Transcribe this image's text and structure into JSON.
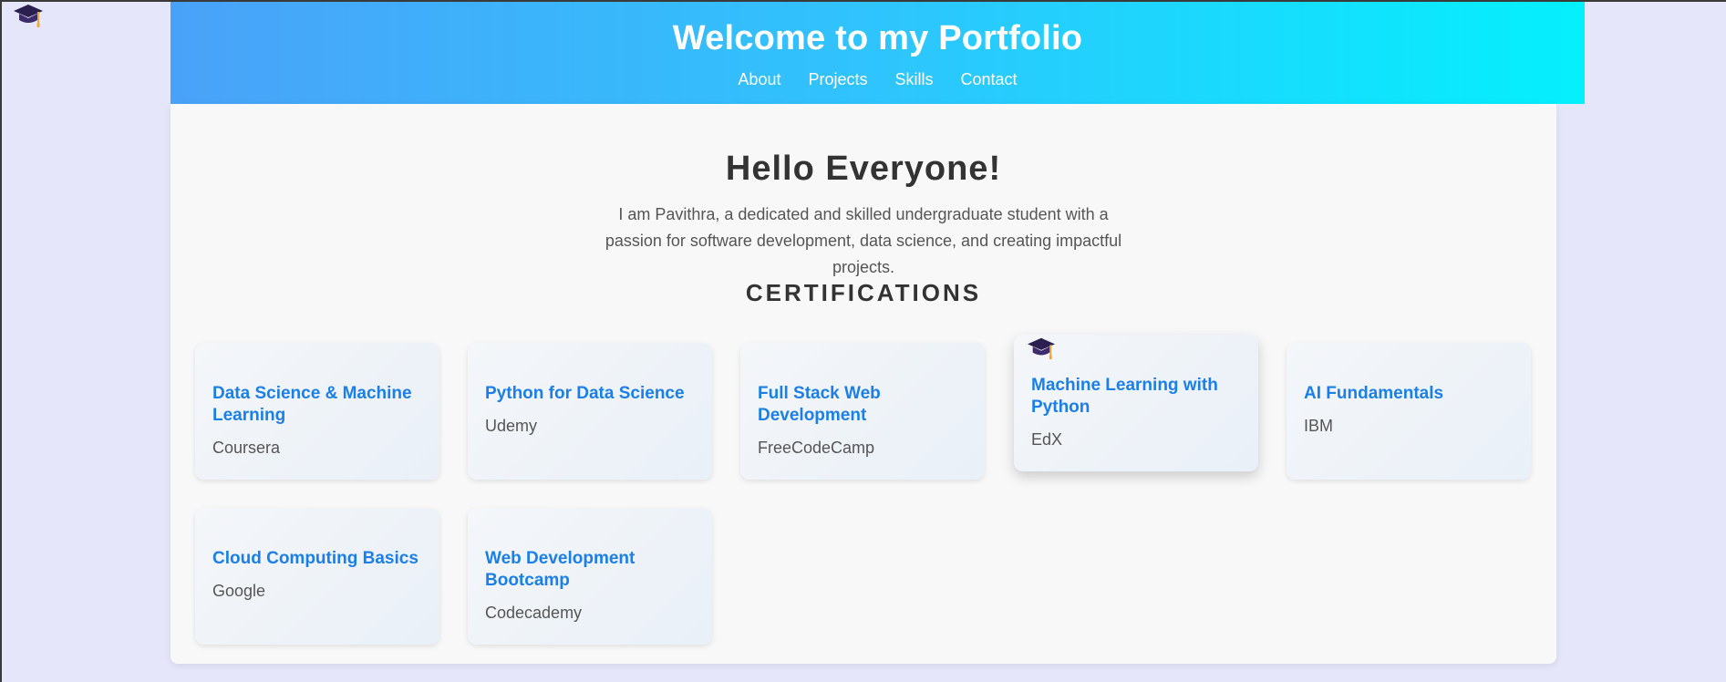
{
  "header": {
    "title": "Welcome to my Portfolio",
    "nav": [
      "About",
      "Projects",
      "Skills",
      "Contact"
    ]
  },
  "hero": {
    "greeting": "Hello Everyone!",
    "intro": "I am Pavithra, a dedicated and skilled undergraduate student with a passion for software development, data science, and creating impactful projects."
  },
  "certifications": {
    "heading": "CERTIFICATIONS",
    "items": [
      {
        "title": "Data Science & Machine Learning",
        "issuer": "Coursera"
      },
      {
        "title": "Python for Data Science",
        "issuer": "Udemy"
      },
      {
        "title": "Full Stack Web Development",
        "issuer": "FreeCodeCamp"
      },
      {
        "title": "Machine Learning with Python",
        "issuer": "EdX"
      },
      {
        "title": "AI Fundamentals",
        "issuer": "IBM"
      },
      {
        "title": "Cloud Computing Basics",
        "issuer": "Google"
      },
      {
        "title": "Web Development Bootcamp",
        "issuer": "Codecademy"
      }
    ]
  },
  "icons": {
    "cursor": "graduation-cap-icon",
    "card_hover_badge": "graduation-cap-icon"
  },
  "colors": {
    "background": "#e6e6fa",
    "header_gradient_start": "#4aa2f8",
    "header_gradient_end": "#04f0fd",
    "card_title": "#1a7fe6",
    "heading_text": "#333333"
  }
}
